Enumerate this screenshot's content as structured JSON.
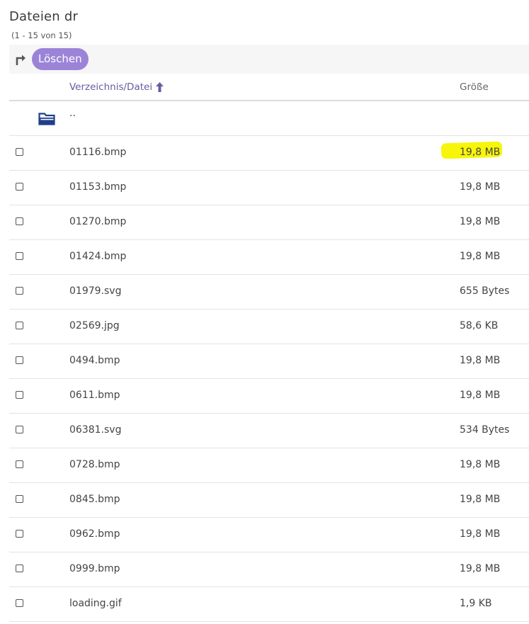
{
  "header": {
    "title": "Dateien dr",
    "range": "(1 - 15 von 15)"
  },
  "toolbar": {
    "delete_label": "Löschen"
  },
  "table": {
    "col_name": "Verzeichnis/Datei",
    "col_size": "Größe",
    "parent_name": "..",
    "rows": [
      {
        "name": "01116.bmp",
        "size": "19,8 MB"
      },
      {
        "name": "01153.bmp",
        "size": "19,8 MB"
      },
      {
        "name": "01270.bmp",
        "size": "19,8 MB"
      },
      {
        "name": "01424.bmp",
        "size": "19,8 MB"
      },
      {
        "name": "01979.svg",
        "size": "655 Bytes"
      },
      {
        "name": "02569.jpg",
        "size": "58,6 KB"
      },
      {
        "name": "0494.bmp",
        "size": "19,8 MB"
      },
      {
        "name": "0611.bmp",
        "size": "19,8 MB"
      },
      {
        "name": "06381.svg",
        "size": "534 Bytes"
      },
      {
        "name": "0728.bmp",
        "size": "19,8 MB"
      },
      {
        "name": "0845.bmp",
        "size": "19,8 MB"
      },
      {
        "name": "0962.bmp",
        "size": "19,8 MB"
      },
      {
        "name": "0999.bmp",
        "size": "19,8 MB"
      },
      {
        "name": "loading.gif",
        "size": "1,9 KB"
      }
    ]
  },
  "colors": {
    "accent": "#9b84d8",
    "highlight": "#f7f50a",
    "folder": "#1f3f8a"
  },
  "icons": {
    "toolbar": "turn-right-arrow-icon",
    "sort": "sort-ascending-arrow-icon",
    "parent": "folder-open-icon"
  }
}
